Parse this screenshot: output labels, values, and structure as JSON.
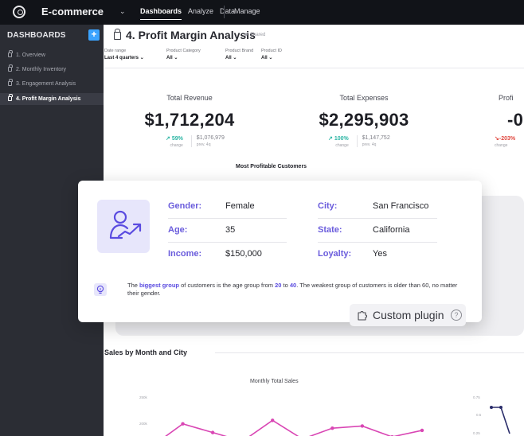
{
  "app": {
    "title": "E-commerce"
  },
  "nav": {
    "items": [
      "Dashboards",
      "Analyze",
      "Data"
    ],
    "manage": "Manage"
  },
  "sidebar": {
    "heading": "DASHBOARDS",
    "add": "+",
    "items": [
      {
        "label": "1. Overview"
      },
      {
        "label": "2. Monthly Inventory"
      },
      {
        "label": "3. Engagement Analysis"
      },
      {
        "label": "4. Profit Margin Analysis"
      }
    ]
  },
  "page": {
    "title": "4. Profit Margin Analysis",
    "shared": "Shared"
  },
  "filters": [
    {
      "label": "Date range",
      "value": "Last 4 quarters"
    },
    {
      "label": "Product Category",
      "value": "All"
    },
    {
      "label": "Product Brand",
      "value": "All"
    },
    {
      "label": "Product ID",
      "value": "All"
    }
  ],
  "kpis": [
    {
      "label": "Total Revenue",
      "value": "$1,712,204",
      "pct": "59%",
      "prev": "$1,076,979",
      "change": "change",
      "prev_label": "prev. 4q",
      "trend": "up"
    },
    {
      "label": "Total Expenses",
      "value": "$2,295,903",
      "pct": "100%",
      "prev": "$1,147,752",
      "change": "change",
      "prev_label": "prev. 4q",
      "trend": "up"
    },
    {
      "label": "Profi",
      "value": "-0",
      "pct": "-203%",
      "change": "change",
      "trend": "down"
    }
  ],
  "most_profitable": {
    "title": "Most Profitable Customers",
    "gender_label": "Gender:",
    "gender": "Female",
    "age_label": "Age:",
    "age": "35",
    "income_label": "Income:",
    "income": "$150,000",
    "city_label": "City:",
    "city": "San Francisco",
    "state_label": "State:",
    "state": "California",
    "loyalty_label": "Loyalty:",
    "loyalty": "Yes",
    "insight": {
      "p1": "The ",
      "h1": "biggest group",
      "p2": " of customers is the age group from ",
      "h2": "20",
      "p3": " to ",
      "h3": "40",
      "p4": ". The weakest group of customers is older than 60, no matter their gender."
    }
  },
  "plugin": {
    "label": "Custom plugin",
    "help": "?"
  },
  "sales": {
    "title": "Sales by Month and City"
  },
  "colors": {
    "accent": "#6a5cdc",
    "positive": "#2bb5a4",
    "negative": "#e0473e",
    "line": "#d946b4",
    "sidebar": "#2b2d34",
    "topbar": "#111318"
  },
  "chart_data": [
    {
      "type": "line",
      "title": "Monthly Total Sales",
      "yticks": [
        "250k",
        "200k"
      ],
      "series": [
        {
          "values": [
            150,
            200,
            180,
            160,
            208,
            165,
            190,
            195,
            170,
            185
          ]
        }
      ]
    },
    {
      "type": "line",
      "yticks": [
        "0.75",
        "0.5",
        "0.25"
      ],
      "series": [
        {
          "values": [
            0.55,
            0.55,
            0.0
          ]
        }
      ]
    }
  ]
}
